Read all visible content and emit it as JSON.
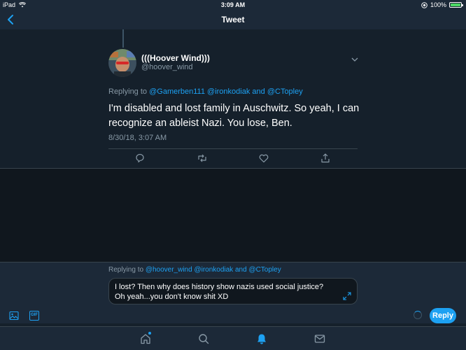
{
  "status_bar": {
    "device": "iPad",
    "time": "3:09 AM",
    "battery": "100%"
  },
  "nav": {
    "title": "Tweet"
  },
  "tweet": {
    "display_name": "(((Hoover Wind)))",
    "handle": "@hoover_wind",
    "replying_prefix": "Replying to",
    "replying_to": [
      "@Gamerben111",
      "@ironkodiak",
      "and",
      "@CTopley"
    ],
    "text": "I'm disabled and lost family in Auschwitz. So yeah, I can recognize an ableist Nazi. You lose, Ben.",
    "timestamp": "8/30/18, 3:07 AM"
  },
  "composer": {
    "replying_prefix": "Replying to",
    "replying_to": [
      "@hoover_wind",
      "@ironkodiak",
      "and",
      "@CTopley"
    ],
    "draft_text": "I lost? Then why does history show nazis used social justice? Oh yeah...you don't know shit XD",
    "gif_label": "GIF",
    "reply_button": "Reply"
  },
  "colors": {
    "accent": "#1da1f2",
    "background": "#15202b",
    "secondary_text": "#8899a6"
  },
  "icons": [
    "back-chevron-icon",
    "wifi-icon",
    "location-icon",
    "battery-icon",
    "chevron-down-icon",
    "reply-icon",
    "retweet-icon",
    "like-icon",
    "share-icon",
    "image-icon",
    "gif-icon",
    "expand-icon",
    "home-icon",
    "search-icon",
    "notifications-icon",
    "messages-icon"
  ]
}
